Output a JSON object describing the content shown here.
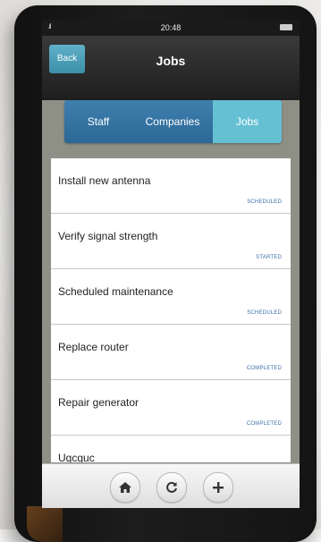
{
  "status_bar": {
    "signal": ".ıl",
    "time": "20:48"
  },
  "nav": {
    "back_label": "Back",
    "title": "Jobs"
  },
  "segments": [
    {
      "label": "Staff",
      "selected": false
    },
    {
      "label": "Companies",
      "selected": false
    },
    {
      "label": "Jobs",
      "selected": true
    }
  ],
  "jobs": [
    {
      "title": "Install new antenna",
      "status": "SCHEDULED"
    },
    {
      "title": "Verify signal strength",
      "status": "STARTED"
    },
    {
      "title": "Scheduled maintenance",
      "status": "SCHEDULED"
    },
    {
      "title": "Replace router",
      "status": "COMPLETED"
    },
    {
      "title": "Repair generator",
      "status": "COMPLETED"
    },
    {
      "title": "Ugcguc",
      "status": ""
    }
  ],
  "toolbar": {
    "home": "home-icon",
    "refresh": "refresh-icon",
    "add": "plus-icon"
  },
  "colors": {
    "accent": "#3f7fae",
    "selected_segment": "#65c0d4",
    "status_text": "#3a6fa8"
  }
}
